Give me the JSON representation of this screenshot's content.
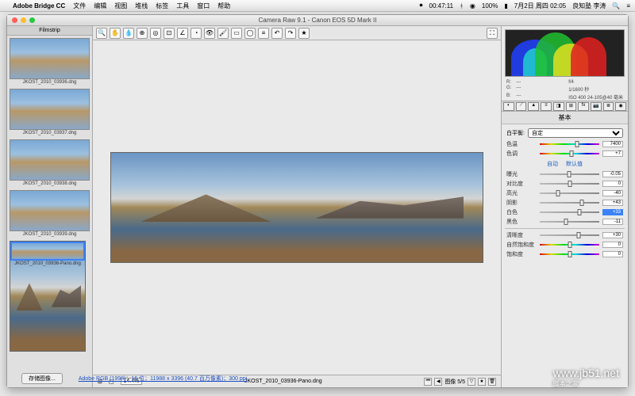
{
  "menubar": {
    "app": "Adobe Bridge CC",
    "items": [
      "文件",
      "编辑",
      "视图",
      "堆栈",
      "标签",
      "工具",
      "窗口",
      "帮助"
    ],
    "right": {
      "time": "00:47:11",
      "battery": "100%",
      "date": "7月2日 周四 02:05",
      "user": "良知塾 李涛"
    }
  },
  "window": {
    "title": "Camera Raw 9.1 - Canon EOS 5D Mark II"
  },
  "filmstrip": {
    "title": "Filmstrip",
    "items": [
      {
        "label": "JKOST_2010_03936.dng"
      },
      {
        "label": "JKOST_2010_03937.dng"
      },
      {
        "label": "JKOST_2010_03938.dng"
      },
      {
        "label": "JKOST_2010_03939.dng"
      },
      {
        "label": "JKOST_2010_03936-Pano.dng",
        "selected": true,
        "pano": true
      }
    ]
  },
  "toolbar": {
    "icons": [
      "zoom",
      "hand",
      "wb-picker",
      "color-sampler",
      "target",
      "crop",
      "straighten",
      "spot",
      "redeye",
      "brush",
      "grad",
      "radial",
      "prefs",
      "menu",
      "rotate-ccw",
      "rotate-cw",
      "star"
    ]
  },
  "status": {
    "zoom": "14.4%",
    "filename": "JKOST_2010_03936-Pano.dng",
    "page": "图像 5/5"
  },
  "rpanel": {
    "info": {
      "R": "---",
      "G": "---",
      "B": "---",
      "aperture": "f/4",
      "shutter": "1/1600 秒",
      "iso": "ISO 400",
      "lens": "24-105@40 毫米"
    },
    "section": "基本",
    "wb": {
      "label": "白平衡:",
      "value": "自定"
    },
    "temp": {
      "label": "色温",
      "value": "7400",
      "pos": 62
    },
    "tint": {
      "label": "色调",
      "value": "+7",
      "pos": 53
    },
    "auto": "自动",
    "default": "默认值",
    "exposure": {
      "label": "曝光",
      "value": "-0.05",
      "pos": 49
    },
    "contrast": {
      "label": "对比度",
      "value": "0",
      "pos": 50
    },
    "highlights": {
      "label": "高光",
      "value": "-40",
      "pos": 30
    },
    "shadows": {
      "label": "阴影",
      "value": "+43",
      "pos": 71
    },
    "whites": {
      "label": "白色",
      "value": "+33",
      "pos": 66,
      "hl": true
    },
    "blacks": {
      "label": "黑色",
      "value": "-11",
      "pos": 44
    },
    "clarity": {
      "label": "清晰度",
      "value": "+30",
      "pos": 65
    },
    "vibrance": {
      "label": "自然饱和度",
      "value": "0",
      "pos": 50
    },
    "saturation": {
      "label": "饱和度",
      "value": "0",
      "pos": 50
    }
  },
  "footer": {
    "save": "存储图像...",
    "meta": "Adobe RGB (1998)；16 位；11988 x 3396 (40.7 百万像素)；300 ppi"
  },
  "watermark": {
    "site": "www.jb51.net",
    "label": "脚本之家"
  }
}
